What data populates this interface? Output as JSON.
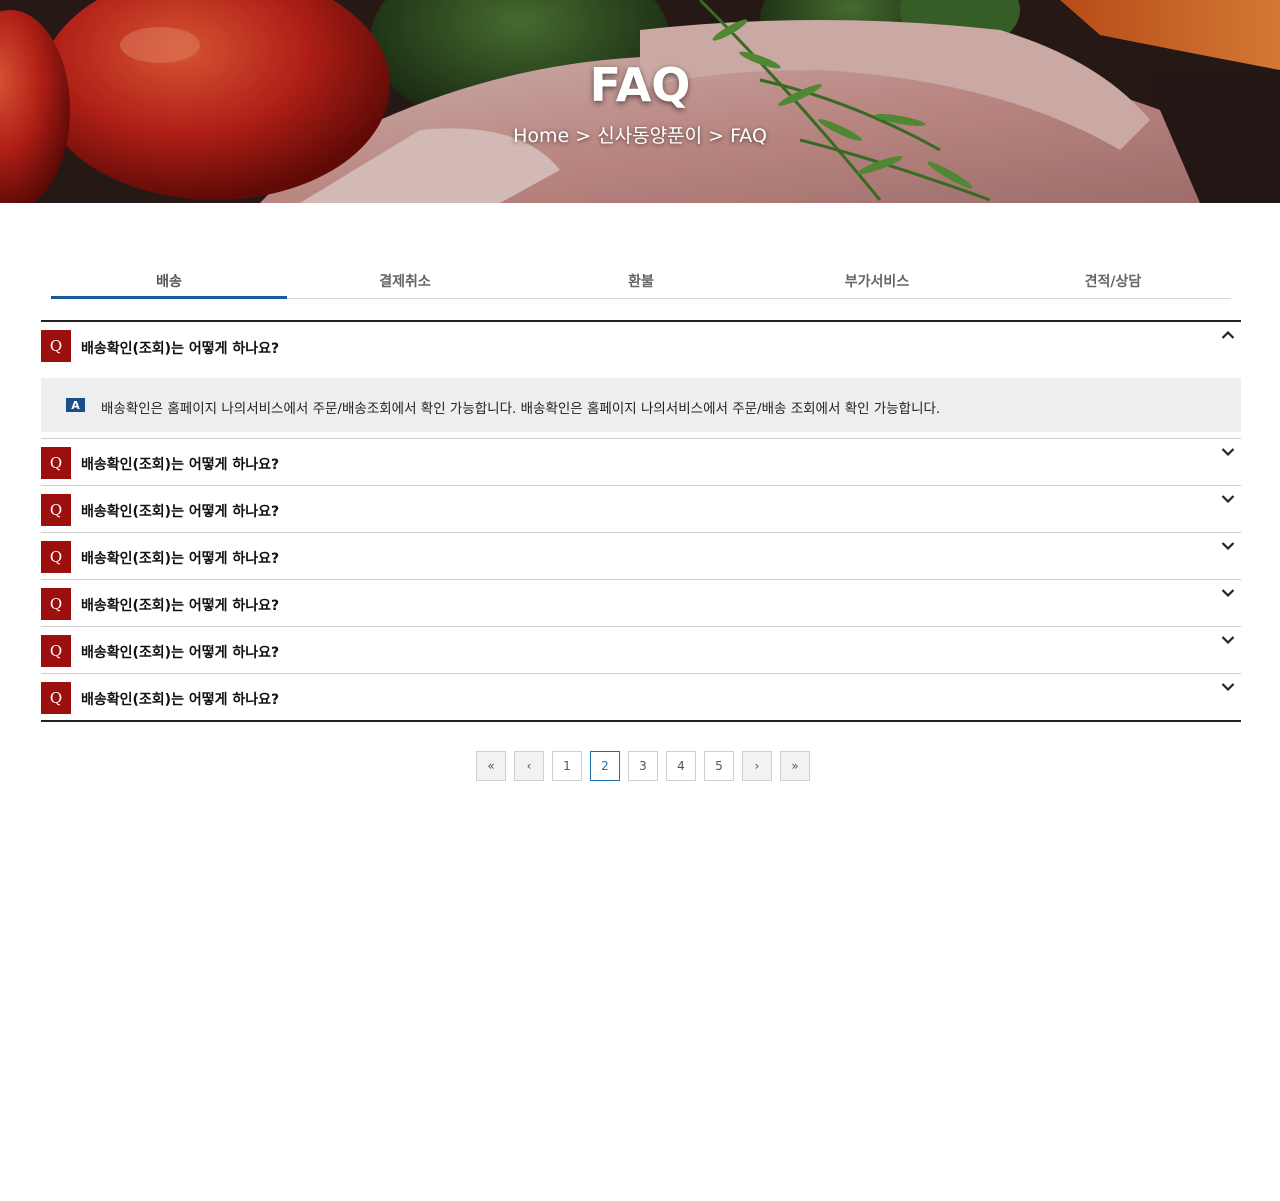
{
  "hero": {
    "title": "FAQ",
    "breadcrumb": [
      "Home",
      ">",
      "신사동양푼이",
      ">",
      "FAQ"
    ]
  },
  "tabs": [
    {
      "label": "배송",
      "active": true
    },
    {
      "label": "결제취소",
      "active": false
    },
    {
      "label": "환불",
      "active": false
    },
    {
      "label": "부가서비스",
      "active": false
    },
    {
      "label": "견적/상담",
      "active": false
    }
  ],
  "faq": {
    "q_badge": "Q",
    "a_badge": "A",
    "items": [
      {
        "question": "배송확인(조회)는 어떻게 하나요?",
        "open": true,
        "answer": "배송확인은 홈페이지 나의서비스에서 주문/배송조회에서 확인 가능합니다. 배송확인은 홈페이지 나의서비스에서 주문/배송 조회에서 확인 가능합니다."
      },
      {
        "question": "배송확인(조회)는 어떻게 하나요?",
        "open": false
      },
      {
        "question": "배송확인(조회)는 어떻게 하나요?",
        "open": false
      },
      {
        "question": "배송확인(조회)는 어떻게 하나요?",
        "open": false
      },
      {
        "question": "배송확인(조회)는 어떻게 하나요?",
        "open": false
      },
      {
        "question": "배송확인(조회)는 어떻게 하나요?",
        "open": false
      },
      {
        "question": "배송확인(조회)는 어떻게 하나요?",
        "open": false
      }
    ]
  },
  "pagination": {
    "first": "«",
    "prev": "‹",
    "pages": [
      "1",
      "2",
      "3",
      "4",
      "5"
    ],
    "current": "2",
    "next": "›",
    "last": "»"
  },
  "colors": {
    "q_badge": "#9b0f0f",
    "a_badge": "#1a4f8b",
    "tab_active_underline": "#1a5a99",
    "page_current": "#1a6fae"
  },
  "icons": {
    "expanded": "chevron-up-icon",
    "collapsed": "chevron-down-icon"
  }
}
